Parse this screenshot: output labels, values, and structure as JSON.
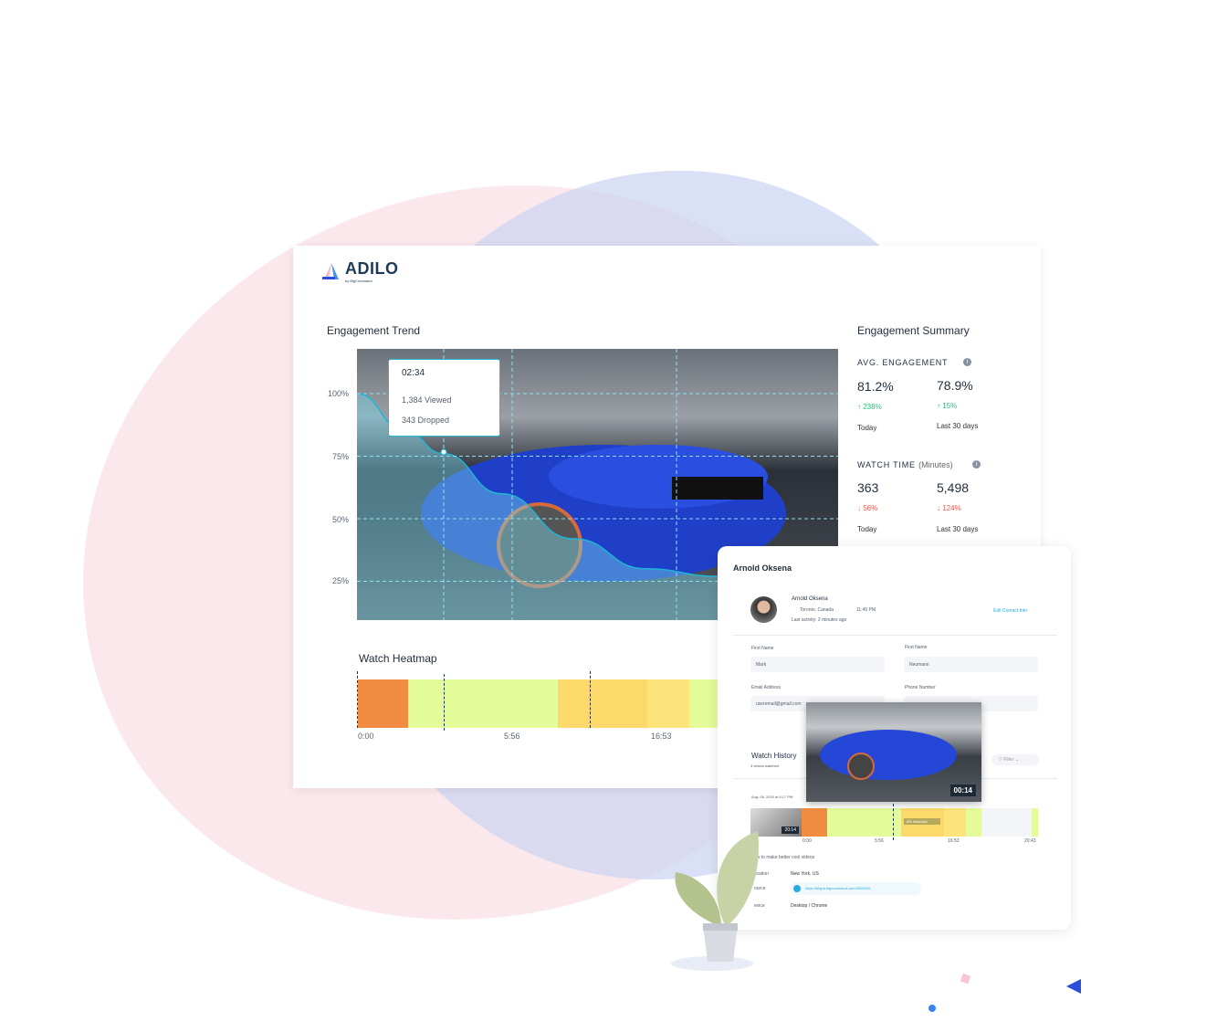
{
  "brand": {
    "name": "ADILO",
    "tagline": "by BigCommand"
  },
  "trend": {
    "title": "Engagement  Trend",
    "y_ticks": [
      "100%",
      "75%",
      "50%",
      "25%"
    ],
    "tooltip": {
      "time": "02:34",
      "viewed": "1,384 Viewed",
      "dropped": "343 Dropped"
    }
  },
  "chart_data": {
    "type": "area",
    "title": "Engagement  Trend",
    "ylabel": "",
    "ylim": [
      0,
      100
    ],
    "y_ticks": [
      "100%",
      "75%",
      "50%",
      "25%"
    ],
    "x_fraction": [
      0,
      0.1,
      0.18,
      0.3,
      0.45,
      0.6,
      0.75,
      0.85
    ],
    "values": [
      100,
      85,
      76,
      60,
      42,
      30,
      27,
      25
    ]
  },
  "heatmap": {
    "title": "Watch Heatmap",
    "ticks": [
      "0:00",
      "5:56",
      "16:53"
    ],
    "segments": [
      {
        "color": "#f28c40",
        "w": 55
      },
      {
        "color": "#e4fb9a",
        "w": 164
      },
      {
        "color": "#fdd96b",
        "w": 98
      },
      {
        "color": "#fde47a",
        "w": 46
      },
      {
        "color": "#e4fb9a",
        "w": 40
      }
    ]
  },
  "summary": {
    "title": "Engagement  Summary",
    "avg": {
      "label": "AVG. ENGAGEMENT",
      "today": "81.2%",
      "today_change": "↑ 238%",
      "month": "78.9%",
      "month_change": "↑ 15%",
      "today_label": "Today",
      "month_label": "Last 30 days"
    },
    "watch": {
      "label": "WATCH TIME",
      "unit": "(Minutes)",
      "today": "363",
      "today_change": "↓ 56%",
      "month": "5,498",
      "month_change": "↓ 124%",
      "today_label": "Today",
      "month_label": "Last 30 days"
    }
  },
  "contact": {
    "title": "Arnold Oksena",
    "name": "Arnold Oksena",
    "location": "Toronto, Canada",
    "time": "11:45 PM",
    "activity": "Last activity: 2 minutes ago",
    "edit": "Edit Contact Info",
    "first_name_label": "First Name",
    "first_name": "Mark",
    "last_name_label": "First Name",
    "last_name": "Neumann",
    "email_label": "Email Address",
    "email": "useremail@gmail.com",
    "phone_label": "Phone Number",
    "history_title": "Watch History",
    "history_sub": "3 videos watched",
    "filter": "Filter",
    "date": "Aug. 06, 2020 at 6:17 PM",
    "thumb_time": "20:14",
    "preview_time": "00:14",
    "watched": "8% Watched",
    "ticks": [
      "0:00",
      "5:56",
      "16:53",
      "20:43"
    ],
    "video_title": "ow to make better cool videos",
    "location_label": "Location",
    "location_value": "New York, US",
    "source_label": "ource",
    "source_value": "https://bfypa.bigcommand.com/4820rED",
    "device_label": "evice",
    "device_value": "Desktop / Chrome"
  }
}
